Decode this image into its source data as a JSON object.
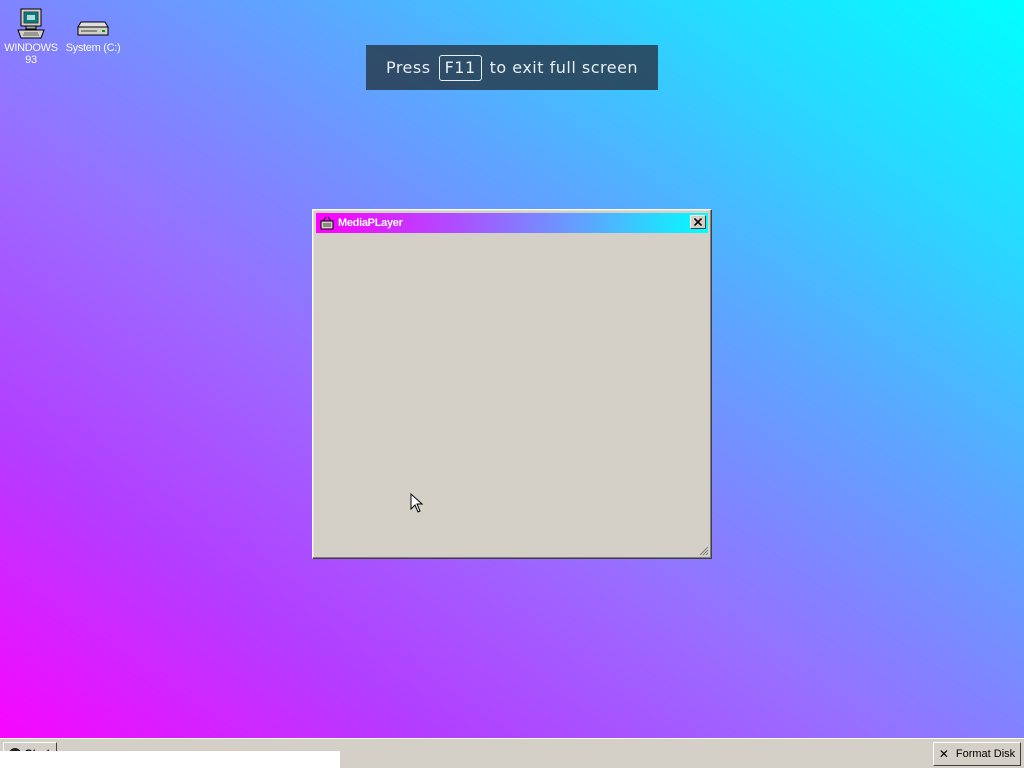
{
  "desktop": {
    "icons": [
      {
        "label": "WINDOWS 93",
        "icon": "computer-icon"
      },
      {
        "label": "System (C:)",
        "icon": "drive-icon"
      }
    ]
  },
  "fullscreen_hint": {
    "prefix": "Press",
    "key": "F11",
    "suffix": "to exit full screen"
  },
  "window": {
    "title": "MediaPLayer",
    "icon": "media-player-icon",
    "close_icon": "close-icon"
  },
  "taskbar": {
    "start_label": "Start",
    "format_disk_label": "Format Disk",
    "format_disk_icon": "x-icon"
  },
  "colors": {
    "window_face": "#d4d0c8",
    "title_gradient_start": "#ff00ff",
    "title_gradient_end": "#00ffff"
  }
}
